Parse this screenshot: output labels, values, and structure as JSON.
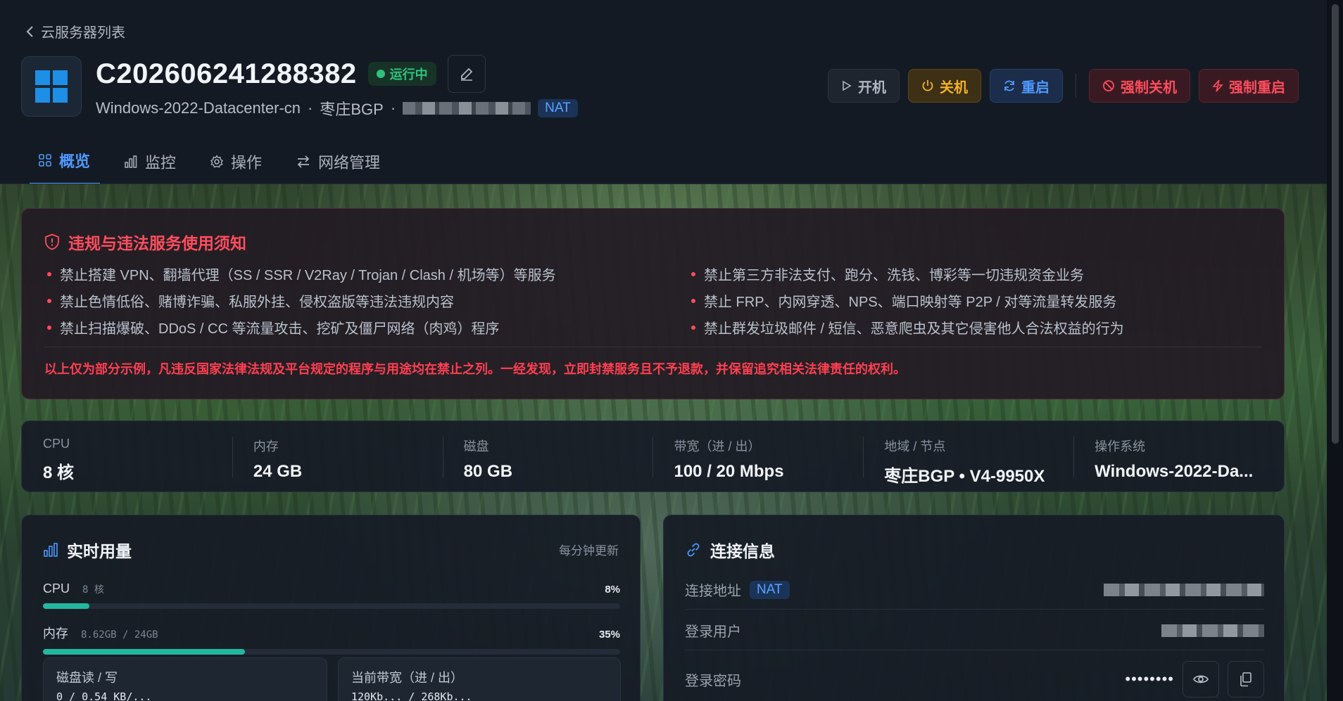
{
  "nav": {
    "back_label": "云服务器列表"
  },
  "server": {
    "id": "C202606241288382",
    "status": "运行中",
    "os_image": "Windows-2022-Datacenter-cn",
    "region": "枣庄BGP",
    "network_tag": "NAT",
    "status_color": "#2ec37c",
    "os_icon": "windows-icon"
  },
  "actions": {
    "start": "开机",
    "shutdown": "关机",
    "reboot": "重启",
    "force_shutdown": "强制关机",
    "force_reboot": "强制重启"
  },
  "tabs": [
    {
      "label": "概览",
      "icon": "grid-icon",
      "active": true
    },
    {
      "label": "监控",
      "icon": "bar-chart-icon",
      "active": false
    },
    {
      "label": "操作",
      "icon": "gear-icon",
      "active": false
    },
    {
      "label": "网络管理",
      "icon": "swap-icon",
      "active": false
    }
  ],
  "notice": {
    "title": "违规与违法服务使用须知",
    "rules": [
      "禁止搭建 VPN、翻墙代理（SS / SSR / V2Ray / Trojan / Clash / 机场等）等服务",
      "禁止第三方非法支付、跑分、洗钱、博彩等一切违规资金业务",
      "禁止色情低俗、赌博诈骗、私服外挂、侵权盗版等违法违规内容",
      "禁止 FRP、内网穿透、NPS、端口映射等 P2P / 对等流量转发服务",
      "禁止扫描爆破、DDoS / CC 等流量攻击、挖矿及僵尸网络（肉鸡）程序",
      "禁止群发垃圾邮件 / 短信、恶意爬虫及其它侵害他人合法权益的行为"
    ],
    "footer": "以上仅为部分示例，凡违反国家法律法规及平台规定的程序与用途均在禁止之列。一经发现，立即封禁服务且不予退款，并保留追究相关法律责任的权利。"
  },
  "specs": [
    {
      "label": "CPU",
      "value": "8 核"
    },
    {
      "label": "内存",
      "value": "24 GB"
    },
    {
      "label": "磁盘",
      "value": "80 GB"
    },
    {
      "label": "带宽（进 / 出）",
      "value": "100 / 20 Mbps"
    },
    {
      "label": "地域 / 节点",
      "value": "枣庄BGP • V4-9950X"
    },
    {
      "label": "操作系统",
      "value": "Windows-2022-Da..."
    }
  ],
  "usage": {
    "title": "实时用量",
    "note": "每分钟更新",
    "cpu": {
      "name": "CPU",
      "sub": "8 核",
      "percent_label": "8%",
      "percent": 8
    },
    "memory": {
      "name": "内存",
      "sub": "8.62GB / 24GB",
      "percent_label": "35%",
      "percent": 35
    },
    "disk_io": {
      "label": "磁盘读 / 写",
      "value": "0 / 0.54 KB/..."
    },
    "bandwidth": {
      "label": "当前带宽（进 / 出）",
      "value": "120Kb... / 268Kb..."
    }
  },
  "connection": {
    "title": "连接信息",
    "address_label": "连接地址",
    "address_tag": "NAT",
    "user_label": "登录用户",
    "password_label": "登录密码",
    "password_mask": "••••••••"
  },
  "colors": {
    "accent": "#4f99ff",
    "danger": "#ff4d5e",
    "warning": "#f2b02a",
    "success": "#2ec37c",
    "progress": "#22b8a0"
  }
}
